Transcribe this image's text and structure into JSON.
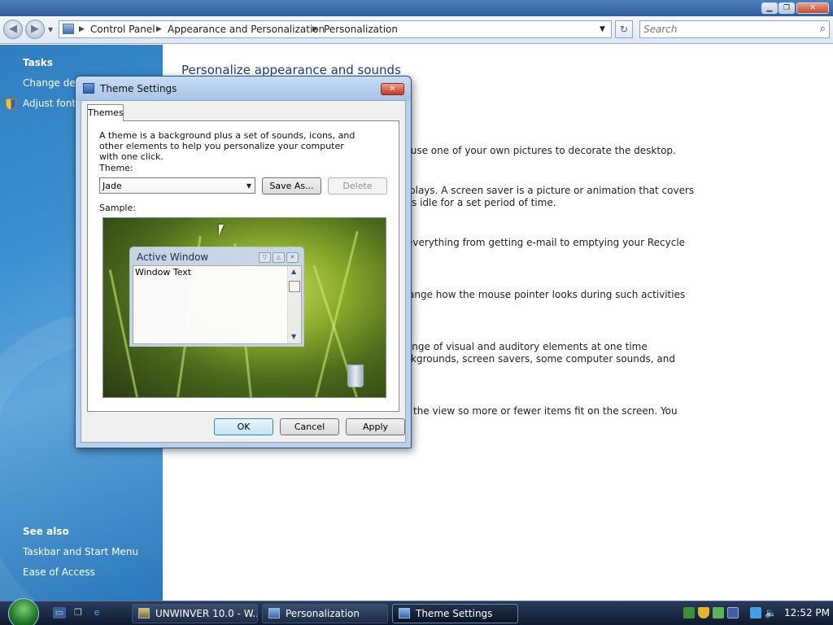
{
  "address": {
    "crumbs": [
      "Control Panel",
      "Appearance and Personalization",
      "Personalization"
    ],
    "search_placeholder": "Search"
  },
  "left_panel": {
    "tasks_heading": "Tasks",
    "tasks": [
      "Change desk",
      "Adjust font s"
    ],
    "see_also_heading": "See also",
    "see_also": [
      "Taskbar and Start Menu",
      "Ease of Access"
    ]
  },
  "main": {
    "title": "Personalize appearance and sounds",
    "desc_lines": [
      "r use one of your own pictures to decorate the desktop.",
      "plays. A screen saver is a picture or animation that covers",
      "s idle for a set period of time.",
      "everything from getting e-mail to emptying your Recycle",
      "ange how the mouse pointer looks during such activities",
      "range of visual and auditory elements at one time",
      "kgrounds, screen savers, some computer sounds, and",
      "the view so more or fewer items fit on the screen. You"
    ]
  },
  "dialog": {
    "title": "Theme Settings",
    "tab": "Themes",
    "description": "A theme is a background plus a set of sounds, icons, and other elements to help you personalize your computer with one click.",
    "theme_label": "Theme:",
    "theme_value": "Jade",
    "save_as": "Save As...",
    "delete": "Delete",
    "sample_label": "Sample:",
    "sample_window_title": "Active Window",
    "sample_window_text": "Window Text",
    "ok": "OK",
    "cancel": "Cancel",
    "apply": "Apply"
  },
  "taskbar": {
    "buttons": [
      "UNWINVER 10.0 - W...",
      "Personalization",
      "Theme Settings"
    ],
    "clock": "12:52 PM"
  }
}
